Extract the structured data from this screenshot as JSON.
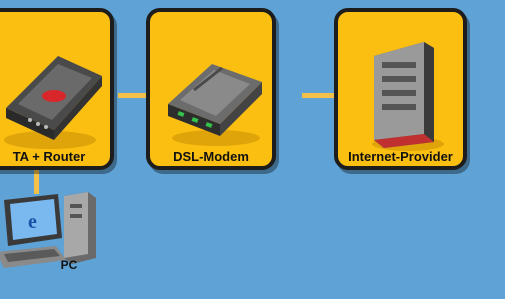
{
  "diagram": {
    "nodes": [
      {
        "id": "ata-router",
        "label": "TA + Router",
        "icon": "router-icon"
      },
      {
        "id": "dsl-modem",
        "label": "DSL-Modem",
        "icon": "modem-icon"
      },
      {
        "id": "internet-provider",
        "label": "Internet-Provider",
        "icon": "server-tower-icon"
      },
      {
        "id": "pc",
        "label": "PC",
        "icon": "desktop-computer-icon"
      }
    ],
    "edges": [
      {
        "from": "ata-router",
        "to": "dsl-modem"
      },
      {
        "from": "dsl-modem",
        "to": "internet-provider"
      },
      {
        "from": "ata-router",
        "to": "pc"
      }
    ]
  },
  "colors": {
    "background": "#5ea2d6",
    "tile": "#fbbf12",
    "tile_border": "#1d1d1d",
    "connector": "#f3c04a"
  }
}
